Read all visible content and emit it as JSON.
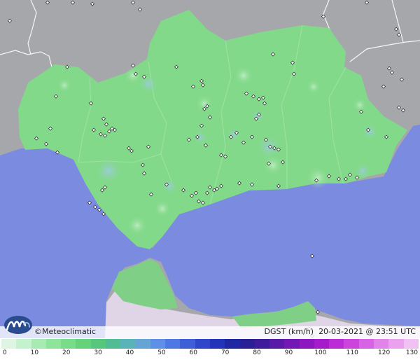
{
  "map": {
    "brand": "©Meteoclimatic",
    "variable": "DGST (km/h)",
    "timestamp": "20-03-2021 @ 23:51 UTC",
    "colors": {
      "sea": "#7b8be0",
      "land_outside": "#a6a7ab",
      "region_fill": "#83d98a",
      "morocco_fill": "#e9ddf0",
      "station_marker": "#ffffff"
    }
  },
  "legend": {
    "unit": "km/h",
    "ticks": [
      "0",
      "10",
      "20",
      "30",
      "40",
      "50",
      "60",
      "70",
      "80",
      "90",
      "100",
      "110",
      "120",
      "130"
    ],
    "colors": [
      "#dff5e4",
      "#c4f2cc",
      "#a8ebb2",
      "#8ee49a",
      "#78dd88",
      "#66d37a",
      "#58c77e",
      "#52bd94",
      "#58b4b8",
      "#66a4d6",
      "#5f8fe6",
      "#4f78e2",
      "#3f5fd8",
      "#2f47cb",
      "#2234b9",
      "#1f27a2",
      "#2a1f95",
      "#3f1c9b",
      "#5a1aa8",
      "#7418b5",
      "#8d18c2",
      "#a51ccd",
      "#bb2bd6",
      "#cb45dd",
      "#d764e4",
      "#e183e9",
      "#eaa2ef",
      "#f0c2f4"
    ]
  }
}
